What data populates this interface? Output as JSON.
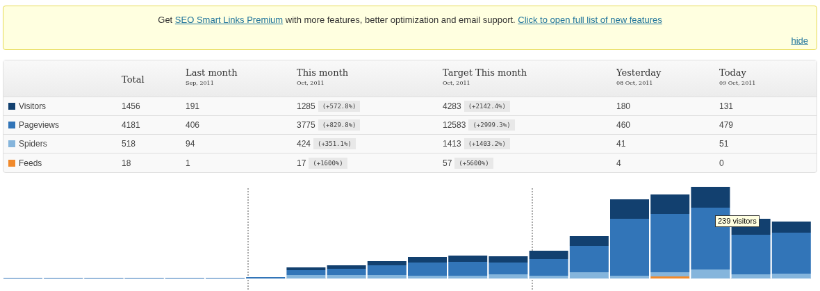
{
  "notice": {
    "before": "Get ",
    "link": "SEO Smart Links Premium",
    "after": " with more features, better optimization and email support. ",
    "link2": "Click to open full list of new features",
    "hide": "hide"
  },
  "table": {
    "columns": [
      {
        "title": "Total"
      },
      {
        "title": "Last month",
        "sub": "Sep, 2011"
      },
      {
        "title": "This month",
        "sub": "Oct, 2011"
      },
      {
        "title": "Target This month",
        "sub": "Oct, 2011"
      },
      {
        "title": "Yesterday",
        "sub": "08 Oct, 2011"
      },
      {
        "title": "Today",
        "sub": "09 Oct, 2011"
      }
    ],
    "rows": [
      {
        "name": "Visitors",
        "color": "#12406f",
        "cells": [
          {
            "value": "1456"
          },
          {
            "value": "191"
          },
          {
            "value": "1285",
            "change": "(+572.8%)"
          },
          {
            "value": "4283",
            "change": "(+2142.4%)"
          },
          {
            "value": "180"
          },
          {
            "value": "131"
          }
        ]
      },
      {
        "name": "Pageviews",
        "color": "#3275b8",
        "cells": [
          {
            "value": "4181"
          },
          {
            "value": "406"
          },
          {
            "value": "3775",
            "change": "(+829.8%)"
          },
          {
            "value": "12583",
            "change": "(+2999.3%)"
          },
          {
            "value": "460"
          },
          {
            "value": "479"
          }
        ]
      },
      {
        "name": "Spiders",
        "color": "#85b5dc",
        "cells": [
          {
            "value": "518"
          },
          {
            "value": "94"
          },
          {
            "value": "424",
            "change": "(+351.1%)"
          },
          {
            "value": "1413",
            "change": "(+1403.2%)"
          },
          {
            "value": "41"
          },
          {
            "value": "51"
          }
        ]
      },
      {
        "name": "Feeds",
        "color": "#f0892b",
        "cells": [
          {
            "value": "18"
          },
          {
            "value": "1"
          },
          {
            "value": "17",
            "change": "(+1600%)"
          },
          {
            "value": "57",
            "change": "(+5600%)"
          },
          {
            "value": "4"
          },
          {
            "value": "0"
          }
        ]
      }
    ]
  },
  "chart": {
    "tooltip": "239 visitors"
  }
}
